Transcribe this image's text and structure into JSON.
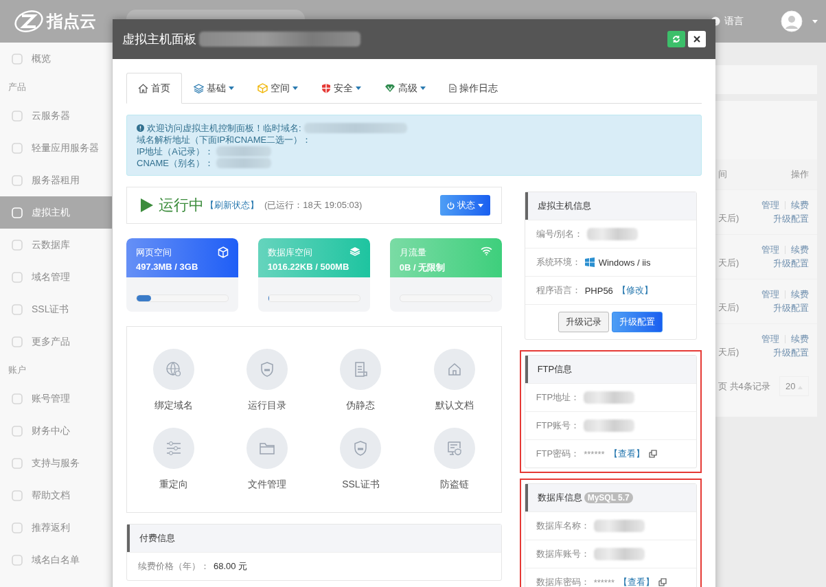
{
  "topbar": {
    "logo": "指点云",
    "language": "语言"
  },
  "sidebar": {
    "items": [
      {
        "kind": "item",
        "label": "概览",
        "selected": false
      },
      {
        "kind": "section",
        "label": "产品"
      },
      {
        "kind": "item",
        "label": "云服务器",
        "selected": false
      },
      {
        "kind": "item",
        "label": "轻量应用服务器",
        "selected": false
      },
      {
        "kind": "item",
        "label": "服务器租用",
        "selected": false
      },
      {
        "kind": "item",
        "label": "虚拟主机",
        "selected": true
      },
      {
        "kind": "item",
        "label": "云数据库",
        "selected": false
      },
      {
        "kind": "item",
        "label": "域名管理",
        "selected": false
      },
      {
        "kind": "item",
        "label": "SSL证书",
        "selected": false
      },
      {
        "kind": "item",
        "label": "更多产品",
        "selected": false
      },
      {
        "kind": "section",
        "label": "账户"
      },
      {
        "kind": "item",
        "label": "账号管理",
        "selected": false
      },
      {
        "kind": "item",
        "label": "财务中心",
        "selected": false
      },
      {
        "kind": "item",
        "label": "支持与服务",
        "selected": false
      },
      {
        "kind": "item",
        "label": "帮助文档",
        "selected": false
      },
      {
        "kind": "item",
        "label": "推荐返利",
        "selected": false
      },
      {
        "kind": "item",
        "label": "域名白名单",
        "selected": false
      }
    ]
  },
  "background_table": {
    "columns": [
      "间",
      "操作"
    ],
    "rows": [
      {
        "due": "天后)",
        "actions": [
          "管理",
          "续费"
        ],
        "upgrade": "升级配置"
      },
      {
        "due": "天后)",
        "actions": [
          "管理",
          "续费"
        ],
        "upgrade": "升级配置"
      },
      {
        "due": "天后)",
        "actions": [
          "管理",
          "续费"
        ],
        "upgrade": "升级配置"
      },
      {
        "due": "天后)",
        "actions": [
          "管理",
          "续费"
        ],
        "upgrade": "升级配置"
      }
    ],
    "pagination": {
      "summary": "页 共4条记录",
      "page_size": "20"
    }
  },
  "modal": {
    "title": "虚拟主机面板",
    "tabs": [
      {
        "label": "首页",
        "selected": true,
        "dropdown": false
      },
      {
        "label": "基础",
        "selected": false,
        "dropdown": true
      },
      {
        "label": "空间",
        "selected": false,
        "dropdown": true
      },
      {
        "label": "安全",
        "selected": false,
        "dropdown": true
      },
      {
        "label": "高级",
        "selected": false,
        "dropdown": true
      },
      {
        "label": "操作日志",
        "selected": false,
        "dropdown": false
      }
    ],
    "notice": [
      {
        "text": "欢迎访问虚拟主机控制面板！临时域名:",
        "blurred": true
      },
      {
        "text": "域名解析地址（下面IP和CNAME二选一）：",
        "blurred": false
      },
      {
        "text": "IP地址（A记录）：",
        "blurred": true
      },
      {
        "text": "CNAME（别名）：",
        "blurred": true
      }
    ],
    "status": {
      "state": "运行中",
      "refresh": "【刷新状态】",
      "uptime": "(已运行：18天 19:05:03)",
      "button": "状态"
    },
    "stats": [
      {
        "title": "网页空间",
        "value": "497.3MB / 3GB",
        "color": "#1f5ef6",
        "level": 0.16
      },
      {
        "title": "数据库空间",
        "value": "1016.22KB / 500MB",
        "color": "#1ec4a0",
        "level": 0.01
      },
      {
        "title": "月流量",
        "value": "0B / 无限制",
        "color": "#3ecf7c",
        "level": 0
      }
    ],
    "tools": [
      "绑定域名",
      "运行目录",
      "伪静态",
      "默认文档",
      "重定向",
      "文件管理",
      "SSL证书",
      "防盗链"
    ],
    "billing": {
      "title": "付费信息",
      "rows": [
        {
          "label": "续费价格（年）：",
          "value": "68.00 元"
        }
      ]
    },
    "panels": [
      {
        "title": "虚拟主机信息",
        "highlighted": false,
        "rows": [
          {
            "kind": "blur",
            "label": "编号/别名："
          },
          {
            "kind": "os",
            "label": "系统环境：",
            "value": "Windows / iis"
          },
          {
            "kind": "lang",
            "label": "程序语言：",
            "value": "PHP56",
            "link": "【修改】"
          }
        ],
        "buttons": [
          {
            "label": "升级记录",
            "primary": false
          },
          {
            "label": "升级配置",
            "primary": true
          }
        ]
      },
      {
        "title": "FTP信息",
        "highlighted": true,
        "rows": [
          {
            "kind": "blur",
            "label": "FTP地址："
          },
          {
            "kind": "blur",
            "label": "FTP账号："
          },
          {
            "kind": "secret",
            "label": "FTP密码：",
            "value": "******",
            "link": "【查看】"
          }
        ]
      },
      {
        "title": "数据库信息",
        "badge": "MySQL 5.7",
        "highlighted": true,
        "rows": [
          {
            "kind": "blur",
            "label": "数据库名称："
          },
          {
            "kind": "blur",
            "label": "数据库账号："
          },
          {
            "kind": "secret",
            "label": "数据库密码：",
            "value": "******",
            "link": "【查看】"
          }
        ]
      }
    ]
  }
}
